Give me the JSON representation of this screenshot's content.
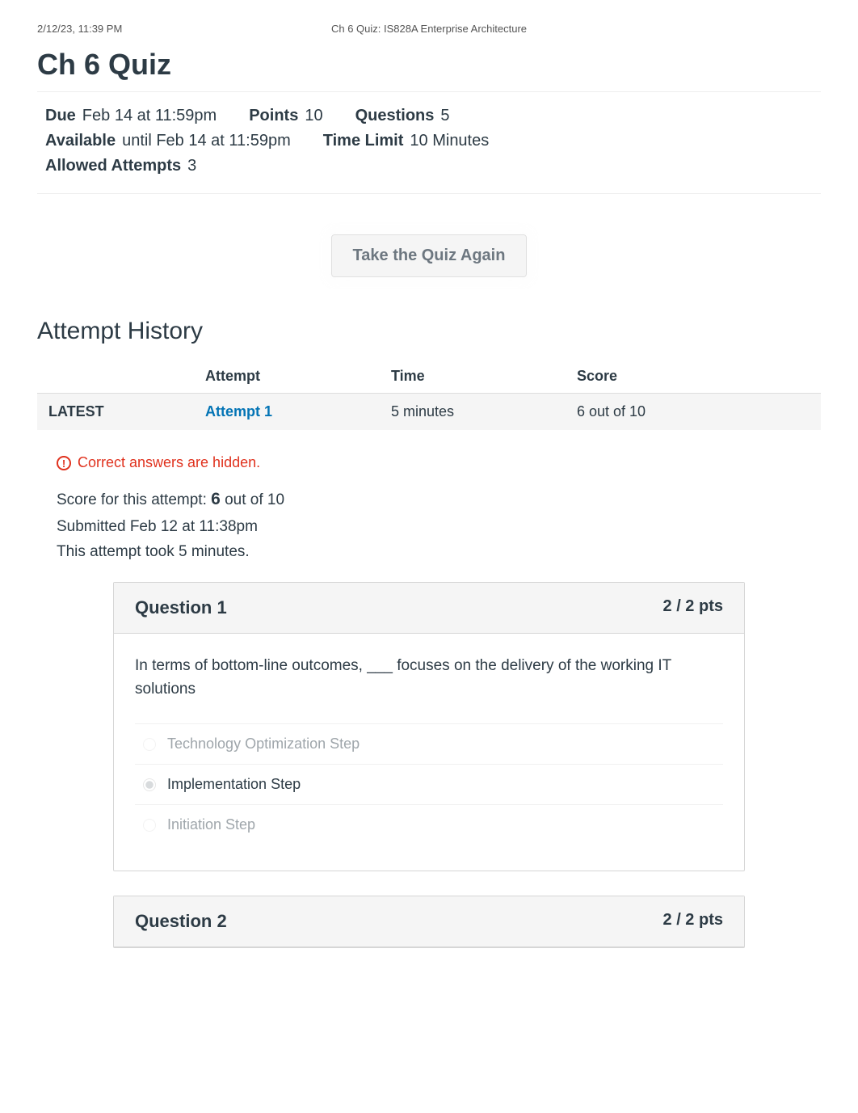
{
  "header": {
    "timestamp": "2/12/23, 11:39 PM",
    "page_title": "Ch 6 Quiz: IS828A Enterprise Architecture"
  },
  "quiz": {
    "title": "Ch 6 Quiz",
    "meta": {
      "due_label": "Due",
      "due_value": "Feb 14 at 11:59pm",
      "points_label": "Points",
      "points_value": "10",
      "questions_label": "Questions",
      "questions_value": "5",
      "available_label": "Available",
      "available_value": "until Feb 14 at 11:59pm",
      "timelimit_label": "Time Limit",
      "timelimit_value": "10 Minutes",
      "allowed_label": "Allowed Attempts",
      "allowed_value": "3"
    },
    "take_again_label": "Take the Quiz Again"
  },
  "history": {
    "title": "Attempt History",
    "columns": {
      "status": "",
      "attempt": "Attempt",
      "time": "Time",
      "score": "Score"
    },
    "rows": [
      {
        "status": "LATEST",
        "attempt_label": "Attempt 1",
        "time": "5 minutes",
        "score": "6 out of 10"
      }
    ]
  },
  "result": {
    "hidden_text": "Correct answers are hidden.",
    "score_prefix": "Score for this attempt: ",
    "score_value": "6",
    "score_suffix": " out of 10",
    "submitted": "Submitted Feb 12 at 11:38pm",
    "duration": "This attempt took 5 minutes."
  },
  "questions": [
    {
      "label": "Question 1",
      "pts": "2 / 2 pts",
      "prompt": "In terms of bottom-line outcomes, ___ focuses on the delivery of the working IT solutions",
      "answers": [
        {
          "text": "Technology Optimization Step",
          "selected": false,
          "dim": true
        },
        {
          "text": "Implementation Step",
          "selected": true,
          "dim": false
        },
        {
          "text": "Initiation Step",
          "selected": false,
          "dim": true
        }
      ]
    },
    {
      "label": "Question 2",
      "pts": "2 / 2 pts",
      "prompt": "",
      "answers": []
    }
  ]
}
